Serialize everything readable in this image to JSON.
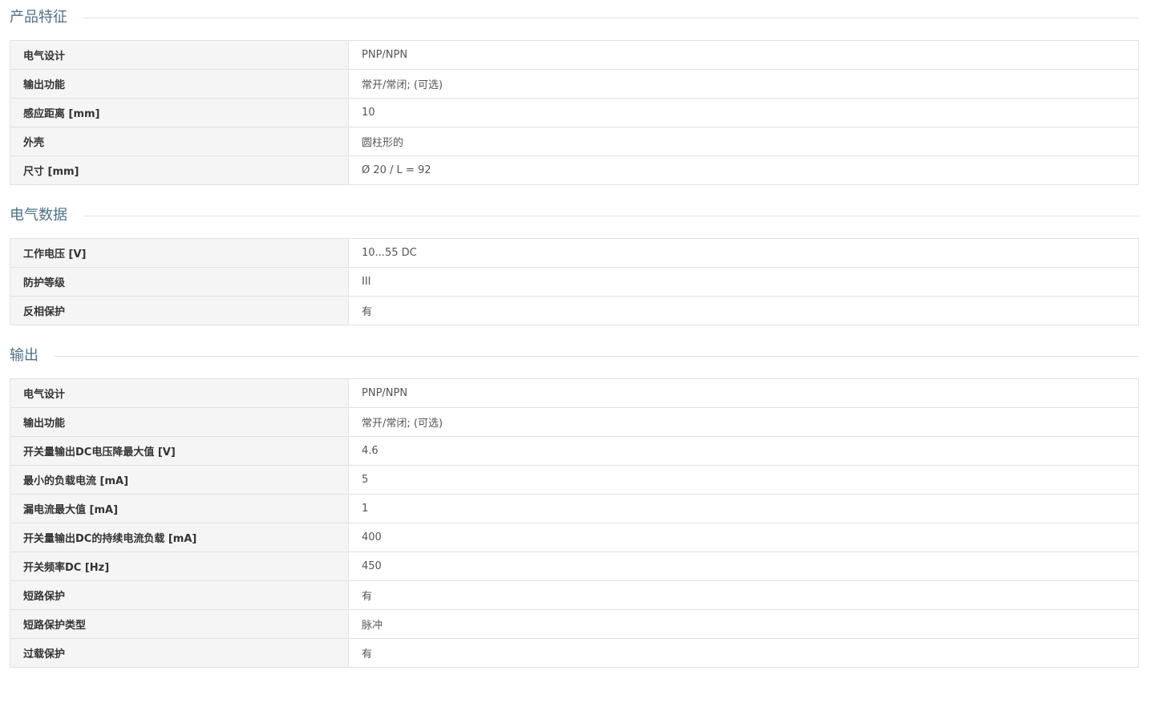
{
  "sections": [
    {
      "title": "产品特征",
      "rows": [
        {
          "label": "电气设计",
          "value": "PNP/NPN"
        },
        {
          "label": "输出功能",
          "value": "常开/常闭; (可选)"
        },
        {
          "label": "感应距离 [mm]",
          "value": "10"
        },
        {
          "label": "外壳",
          "value": "圆柱形的"
        },
        {
          "label": "尺寸 [mm]",
          "value": "Ø 20 / L = 92"
        }
      ]
    },
    {
      "title": "电气数据",
      "rows": [
        {
          "label": "工作电压 [V]",
          "value": "10...55 DC"
        },
        {
          "label": "防护等级",
          "value": "III"
        },
        {
          "label": "反相保护",
          "value": "有"
        }
      ]
    },
    {
      "title": "输出",
      "rows": [
        {
          "label": "电气设计",
          "value": "PNP/NPN"
        },
        {
          "label": "输出功能",
          "value": "常开/常闭; (可选)"
        },
        {
          "label": "开关量输出DC电压降最大值 [V]",
          "value": "4.6"
        },
        {
          "label": "最小的负载电流 [mA]",
          "value": "5"
        },
        {
          "label": "漏电流最大值 [mA]",
          "value": "1"
        },
        {
          "label": "开关量输出DC的持续电流负载 [mA]",
          "value": "400"
        },
        {
          "label": "开关频率DC [Hz]",
          "value": "450"
        },
        {
          "label": "短路保护",
          "value": "有"
        },
        {
          "label": "短路保护类型",
          "value": "脉冲"
        },
        {
          "label": "过载保护",
          "value": "有"
        }
      ]
    }
  ]
}
